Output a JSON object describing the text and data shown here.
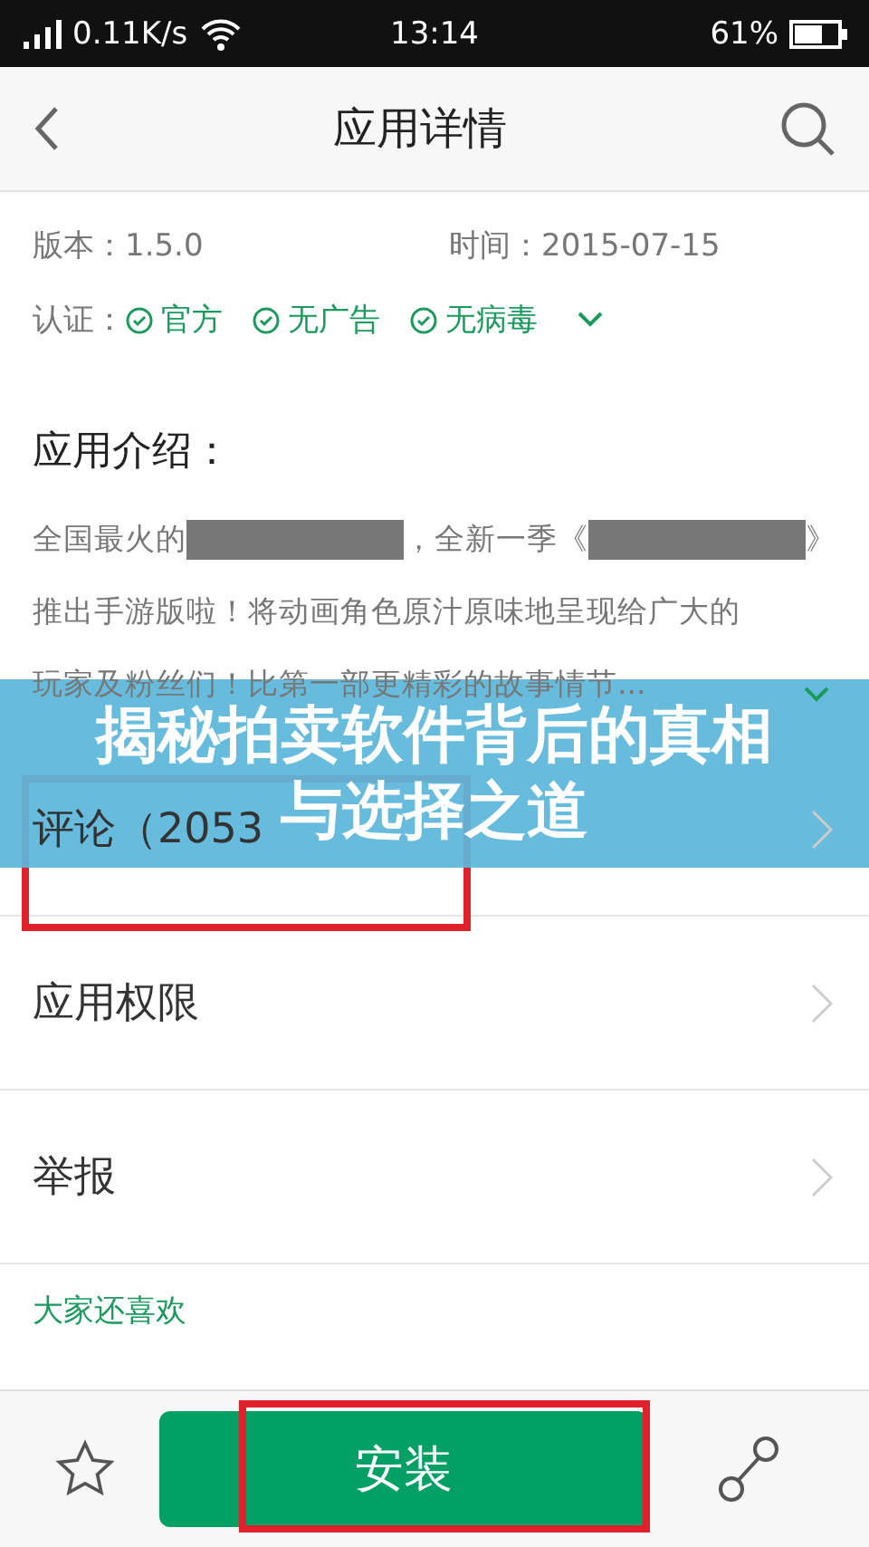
{
  "status_bar": {
    "speed": "0.11K/s",
    "time": "13:14",
    "battery": "61%"
  },
  "header": {
    "title": "应用详情"
  },
  "info": {
    "version": "版本：1.5.0",
    "date": "时间：2015-07-15",
    "cert_label": "认证：",
    "badges": [
      "官方",
      "无广告",
      "无病毒"
    ]
  },
  "intro": {
    "title": "应用介绍：",
    "lines": [
      [
        {
          "kind": "text",
          "text": "全国最火的"
        },
        {
          "kind": "redacted"
        },
        {
          "kind": "text",
          "text": "，全新一季《"
        },
        {
          "kind": "redacted"
        },
        {
          "kind": "text",
          "text": "》"
        }
      ],
      [
        {
          "kind": "text",
          "text": "推出手游版啦！将动画角色原汁原味地呈现给广大的"
        }
      ],
      [
        {
          "kind": "text",
          "text": "玩家及粉丝们！比第一部更精彩的故事情节..."
        }
      ]
    ]
  },
  "rows": [
    {
      "label": "评论（2053",
      "highlighted": true
    },
    {
      "label": "应用权限",
      "highlighted": false
    },
    {
      "label": "举报",
      "highlighted": false
    }
  ],
  "recommend": {
    "title": "大家还喜欢"
  },
  "banner": {
    "lines": [
      "揭秘拍卖软件背后的真相",
      "与选择之道"
    ]
  },
  "bottom_bar": {
    "install": "安装",
    "install_highlighted": true
  }
}
